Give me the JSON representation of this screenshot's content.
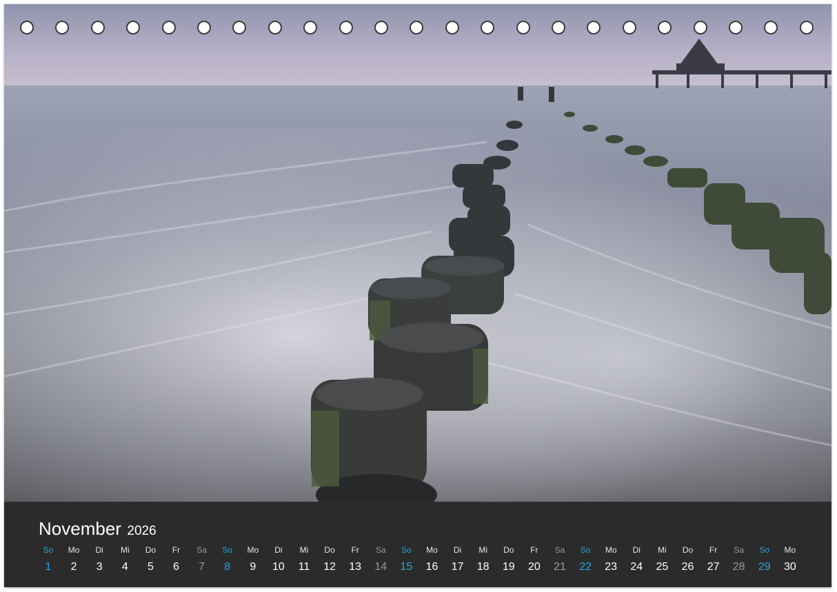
{
  "calendar": {
    "month": "November",
    "year": "2026",
    "days": [
      {
        "name": "So",
        "num": "1",
        "type": "sun"
      },
      {
        "name": "Mo",
        "num": "2",
        "type": "week"
      },
      {
        "name": "Di",
        "num": "3",
        "type": "week"
      },
      {
        "name": "Mi",
        "num": "4",
        "type": "week"
      },
      {
        "name": "Do",
        "num": "5",
        "type": "week"
      },
      {
        "name": "Fr",
        "num": "6",
        "type": "week"
      },
      {
        "name": "Sa",
        "num": "7",
        "type": "sat"
      },
      {
        "name": "So",
        "num": "8",
        "type": "sun"
      },
      {
        "name": "Mo",
        "num": "9",
        "type": "week"
      },
      {
        "name": "Di",
        "num": "10",
        "type": "week"
      },
      {
        "name": "Mi",
        "num": "11",
        "type": "week"
      },
      {
        "name": "Do",
        "num": "12",
        "type": "week"
      },
      {
        "name": "Fr",
        "num": "13",
        "type": "week"
      },
      {
        "name": "Sa",
        "num": "14",
        "type": "sat"
      },
      {
        "name": "So",
        "num": "15",
        "type": "sun"
      },
      {
        "name": "Mo",
        "num": "16",
        "type": "week"
      },
      {
        "name": "Di",
        "num": "17",
        "type": "week"
      },
      {
        "name": "Mi",
        "num": "18",
        "type": "week"
      },
      {
        "name": "Do",
        "num": "19",
        "type": "week"
      },
      {
        "name": "Fr",
        "num": "20",
        "type": "week"
      },
      {
        "name": "Sa",
        "num": "21",
        "type": "sat"
      },
      {
        "name": "So",
        "num": "22",
        "type": "sun"
      },
      {
        "name": "Mo",
        "num": "23",
        "type": "week"
      },
      {
        "name": "Di",
        "num": "24",
        "type": "week"
      },
      {
        "name": "Mi",
        "num": "25",
        "type": "week"
      },
      {
        "name": "Do",
        "num": "26",
        "type": "week"
      },
      {
        "name": "Fr",
        "num": "27",
        "type": "week"
      },
      {
        "name": "Sa",
        "num": "28",
        "type": "sat"
      },
      {
        "name": "So",
        "num": "29",
        "type": "sun"
      },
      {
        "name": "Mo",
        "num": "30",
        "type": "week"
      }
    ]
  },
  "colors": {
    "sunday": "#2aa3e0",
    "saturday": "#9a9a9a",
    "weekday": "#ffffff",
    "footer": "#2b2b2b"
  },
  "photo": {
    "subject": "groynes-in-sea-with-pier-photo"
  },
  "binding": {
    "hole_count": 23
  }
}
